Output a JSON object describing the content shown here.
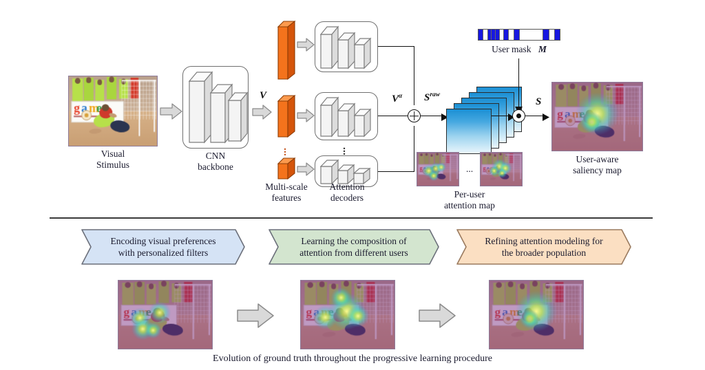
{
  "figure": {
    "type": "architecture-diagram",
    "title": "User-aware saliency prediction pipeline",
    "caption": "Evolution of ground truth throughout the progressive learning procedure"
  },
  "pipeline": {
    "stimulus_label": "Visual\nStimulus",
    "stimulus_line1": "Visual",
    "stimulus_line2": "Stimulus",
    "backbone_line1": "CNN",
    "backbone_line2": "backbone",
    "features_line1": "Multi-scale",
    "features_line2": "features",
    "decoders_line1": "Attention",
    "decoders_line2": "decoders",
    "peruser_line1": "Per-user",
    "peruser_line2": "attention map",
    "output_line1": "User-aware",
    "output_line2": "saliency map",
    "user_mask_label": "User mask",
    "user_mask_symbol": "M",
    "symbol_v": "V",
    "symbol_v_alpha_base": "V",
    "symbol_v_alpha_sup": "α",
    "symbol_s_raw_base": "S",
    "symbol_s_raw_sup": "raw",
    "symbol_s": "S",
    "ellipsis": "...",
    "feature_branch_count": 3,
    "decoder_branch_count": 3,
    "stacked_map_count": 5,
    "mask_segments": [
      {
        "on": true,
        "w": 5
      },
      {
        "on": false,
        "w": 5
      },
      {
        "on": true,
        "w": 4
      },
      {
        "on": true,
        "w": 4
      },
      {
        "on": true,
        "w": 4
      },
      {
        "on": false,
        "w": 5
      },
      {
        "on": true,
        "w": 5
      },
      {
        "on": false,
        "w": 6
      },
      {
        "on": true,
        "w": 6
      },
      {
        "on": false,
        "w": 28
      },
      {
        "on": true,
        "w": 7
      },
      {
        "on": false,
        "w": 6
      },
      {
        "on": true,
        "w": 6
      }
    ]
  },
  "stages": [
    {
      "id": "stage-encoding",
      "line1": "Encoding visual preferences",
      "line2": "with personalized filters",
      "fill": "#d5e3f5",
      "stroke": "#6b6f7a"
    },
    {
      "id": "stage-composition",
      "line1": "Learning the composition of",
      "line2": "attention from different users",
      "fill": "#d3e5cf",
      "stroke": "#6b6f7a"
    },
    {
      "id": "stage-refining",
      "line1": "Refining attention modeling for",
      "line2": "the broader population",
      "fill": "#fbdfc2",
      "stroke": "#9a7a5e"
    }
  ],
  "evolution": {
    "caption": "Evolution of ground truth throughout the progressive learning procedure",
    "step_count": 3,
    "arrow_count": 2
  },
  "colors": {
    "feature_orange": "#ef6c16",
    "feature_orange_dark": "#c4500a",
    "mask_blue": "#1717e0",
    "map_blue_top": "#1b8fd4",
    "map_blue_bottom": "#eaf6fc",
    "arrow_gray": "#d3d3d3",
    "arrow_stroke": "#7d7d7d",
    "line_black": "#111111",
    "slab_face": "#f2f2f2",
    "slab_stroke": "#808080",
    "divider": "#3a3a3a",
    "text": "#1a1a2e"
  }
}
